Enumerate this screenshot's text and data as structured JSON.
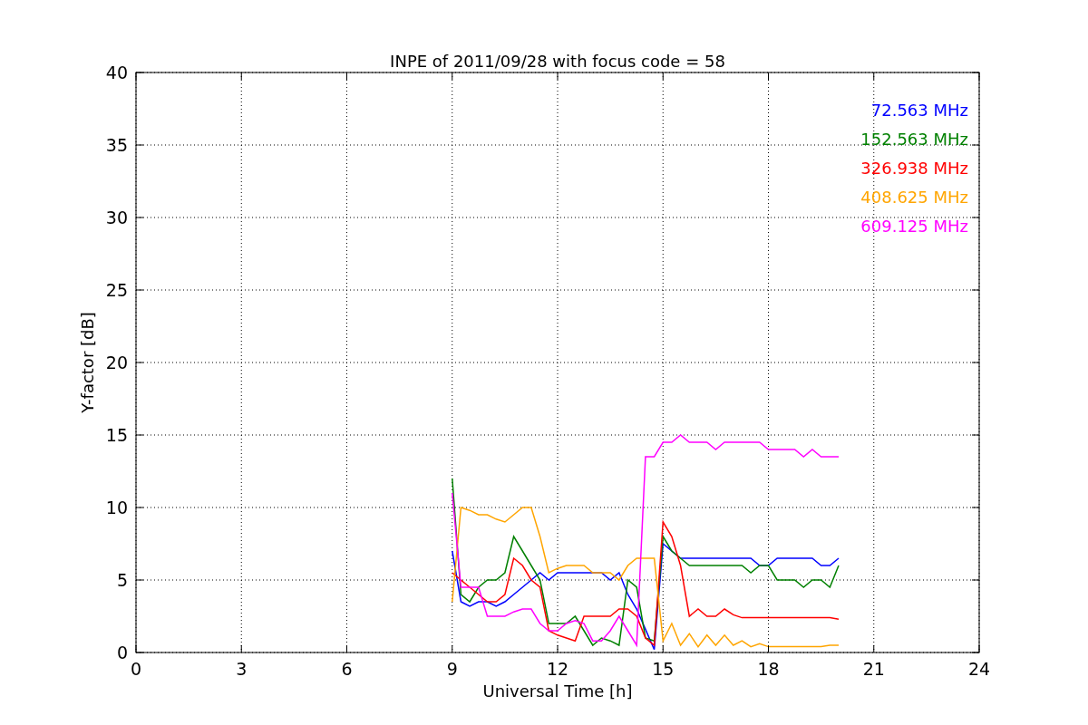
{
  "chart_data": {
    "type": "line",
    "title": "INPE of 2011/09/28 with focus code = 58",
    "xlabel": "Universal Time [h]",
    "ylabel": "Y-factor [dB]",
    "x": [
      9,
      9.25,
      9.5,
      9.75,
      10,
      10.25,
      10.5,
      10.75,
      11,
      11.25,
      11.5,
      11.75,
      12,
      12.25,
      12.5,
      12.75,
      13,
      13.25,
      13.5,
      13.75,
      14,
      14.25,
      14.5,
      14.75,
      15,
      15.25,
      15.5,
      15.75,
      16,
      16.25,
      16.5,
      16.75,
      17,
      17.25,
      17.5,
      17.75,
      18,
      18.25,
      18.5,
      18.75,
      19,
      19.25,
      19.5,
      19.75,
      20
    ],
    "series": [
      {
        "name": "72.563 MHz",
        "color": "#0000ff",
        "values": [
          7,
          3.5,
          3.2,
          3.5,
          3.5,
          3.2,
          3.5,
          4,
          4.5,
          5,
          5.5,
          5,
          5.5,
          5.5,
          5.5,
          5.5,
          5.5,
          5.5,
          5,
          5.5,
          4,
          3,
          1.6,
          0.2,
          7.5,
          7,
          6.5,
          6.5,
          6.5,
          6.5,
          6.5,
          6.5,
          6.5,
          6.5,
          6.5,
          6,
          6,
          6.5,
          6.5,
          6.5,
          6.5,
          6.5,
          6,
          6,
          6.5
        ]
      },
      {
        "name": "152.563 MHz",
        "color": "#008000",
        "values": [
          12,
          4,
          3.5,
          4.5,
          5,
          5,
          5.5,
          8,
          7,
          6,
          5,
          2,
          2,
          2,
          2.5,
          1.5,
          0.5,
          1,
          0.8,
          0.5,
          5,
          4.5,
          1,
          0.8,
          8,
          7,
          6.5,
          6,
          6,
          6,
          6,
          6,
          6,
          6,
          5.5,
          6,
          6,
          5,
          5,
          5,
          4.5,
          5,
          5,
          4.5,
          6
        ]
      },
      {
        "name": "326.938 MHz",
        "color": "#ff0000",
        "values": [
          5.5,
          5,
          4.5,
          4,
          3.5,
          3.5,
          4,
          6.5,
          6,
          5,
          4.5,
          1.5,
          1.2,
          1,
          0.8,
          2.5,
          2.5,
          2.5,
          2.5,
          3,
          3,
          2.5,
          1,
          0.5,
          9,
          8,
          6,
          2.5,
          3,
          2.5,
          2.5,
          3,
          2.6,
          2.4,
          2.4,
          2.4,
          2.4,
          2.4,
          2.4,
          2.4,
          2.4,
          2.4,
          2.4,
          2.4,
          2.3
        ]
      },
      {
        "name": "408.625 MHz",
        "color": "#ffa500",
        "values": [
          3.5,
          10,
          9.8,
          9.5,
          9.5,
          9.2,
          9,
          9.5,
          10,
          10,
          8,
          5.5,
          5.8,
          6,
          6,
          6,
          5.5,
          5.5,
          5.5,
          5,
          6,
          6.5,
          6.5,
          6.5,
          0.8,
          2,
          0.5,
          1.3,
          0.4,
          1.2,
          0.5,
          1.2,
          0.5,
          0.8,
          0.4,
          0.6,
          0.4,
          0.4,
          0.4,
          0.4,
          0.4,
          0.4,
          0.4,
          0.5,
          0.5
        ]
      },
      {
        "name": "609.125 MHz",
        "color": "#ff00ff",
        "values": [
          11,
          4.5,
          4.5,
          4.5,
          2.5,
          2.5,
          2.5,
          2.8,
          3,
          3,
          2,
          1.5,
          1.5,
          2,
          2.2,
          2,
          0.8,
          0.8,
          1.5,
          2.5,
          1.5,
          0.5,
          13.5,
          13.5,
          14.5,
          14.5,
          15,
          14.5,
          14.5,
          14.5,
          14,
          14.5,
          14.5,
          14.5,
          14.5,
          14.5,
          14,
          14,
          14,
          14,
          13.5,
          14,
          13.5,
          13.5,
          13.5
        ]
      }
    ],
    "xlim": [
      0,
      24
    ],
    "ylim": [
      0,
      40
    ],
    "xticks": [
      0,
      3,
      6,
      9,
      12,
      15,
      18,
      21,
      24
    ],
    "yticks": [
      0,
      5,
      10,
      15,
      20,
      25,
      30,
      35,
      40
    ],
    "grid": true
  }
}
